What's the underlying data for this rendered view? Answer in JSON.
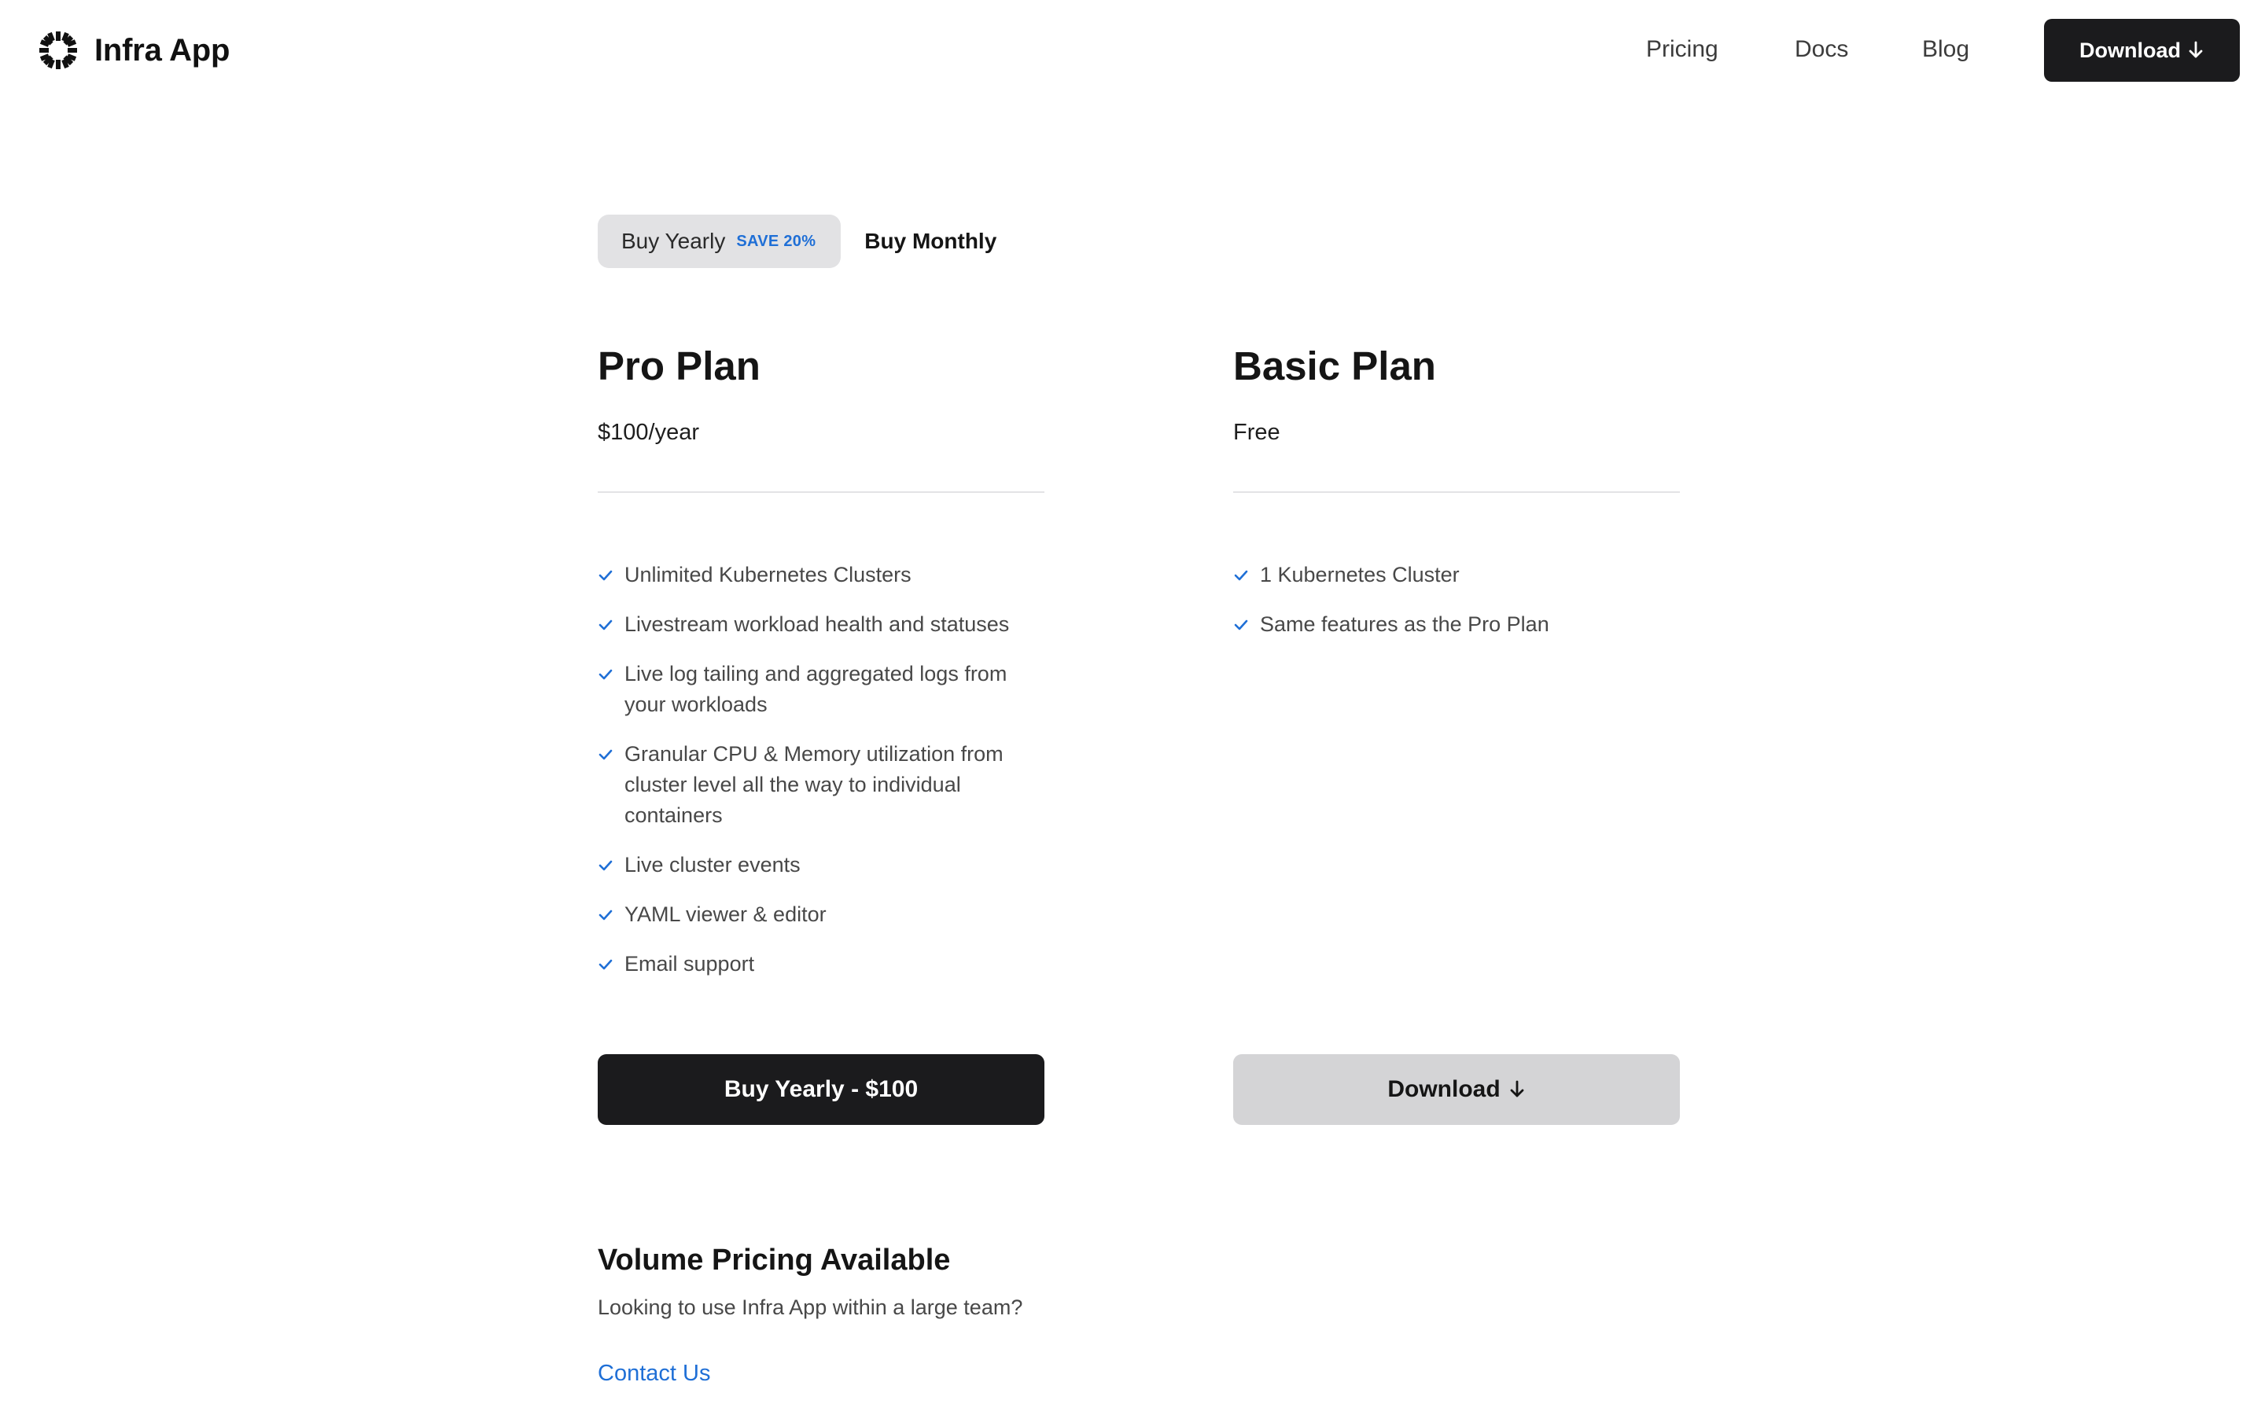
{
  "nav": {
    "brand_name": "Infra App",
    "links": [
      "Pricing",
      "Docs",
      "Blog"
    ],
    "download_label": "Download"
  },
  "billing_toggle": {
    "yearly_label": "Buy Yearly",
    "save_badge": "SAVE 20%",
    "monthly_label": "Buy Monthly",
    "selected": "yearly"
  },
  "plans": [
    {
      "title": "Pro Plan",
      "price": "$100/year",
      "features": [
        "Unlimited Kubernetes Clusters",
        "Livestream workload health and statuses",
        "Live log tailing and aggregated logs from your workloads",
        "Granular CPU & Memory utilization from cluster level all the way to individual containers",
        "Live cluster events",
        "YAML viewer & editor",
        "Email support"
      ],
      "cta_label": "Buy Yearly - $100"
    },
    {
      "title": "Basic Plan",
      "price": "Free",
      "features": [
        "1 Kubernetes Cluster",
        "Same features as the Pro Plan"
      ],
      "cta_label": "Download"
    }
  ],
  "volume": {
    "title": "Volume Pricing Available",
    "description": "Looking to use Infra App within a large team?",
    "contact_label": "Contact Us"
  },
  "colors": {
    "accent": "#1f6fd6",
    "dark_button": "#1b1b1d",
    "light_button": "#d4d4d6",
    "toggle_active_bg": "#e2e2e4"
  },
  "icons": {
    "brand": "sunburst-logo-icon",
    "feature": "check-icon",
    "download": "arrow-down-icon"
  }
}
